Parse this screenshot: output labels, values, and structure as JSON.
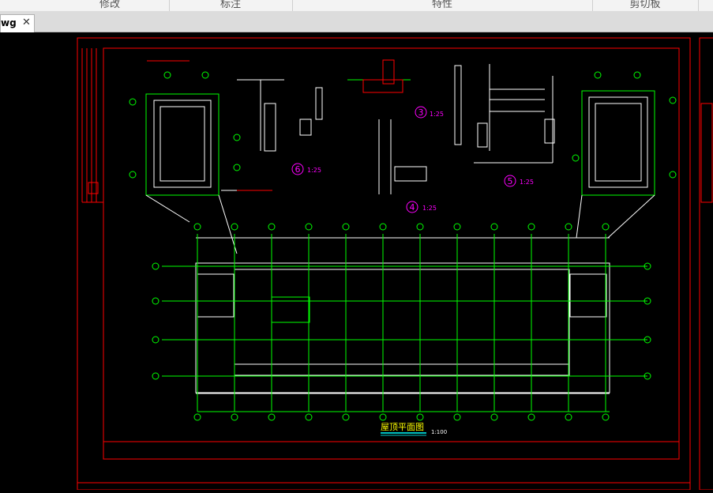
{
  "ribbon": {
    "groups": [
      {
        "label": "修改"
      },
      {
        "label": "标注"
      },
      {
        "label": "特性"
      },
      {
        "label": "剪切板"
      }
    ]
  },
  "document_tab": {
    "label": "wg",
    "close_glyph": "✕"
  },
  "drawing": {
    "title": "屋顶平面图",
    "title_scale": "1:100",
    "details": [
      {
        "number": "3",
        "scale": "1:25"
      },
      {
        "number": "6",
        "scale": "1:25"
      },
      {
        "number": "5",
        "scale": "1:25"
      },
      {
        "number": "4",
        "scale": "1:25"
      }
    ],
    "colors": {
      "frame": "#ff0000",
      "lines": "#00ff00",
      "white_lines": "#ffffff",
      "title": "#ffff00",
      "detail_circle": "#ff00ff",
      "accent": "#00ffff"
    }
  }
}
